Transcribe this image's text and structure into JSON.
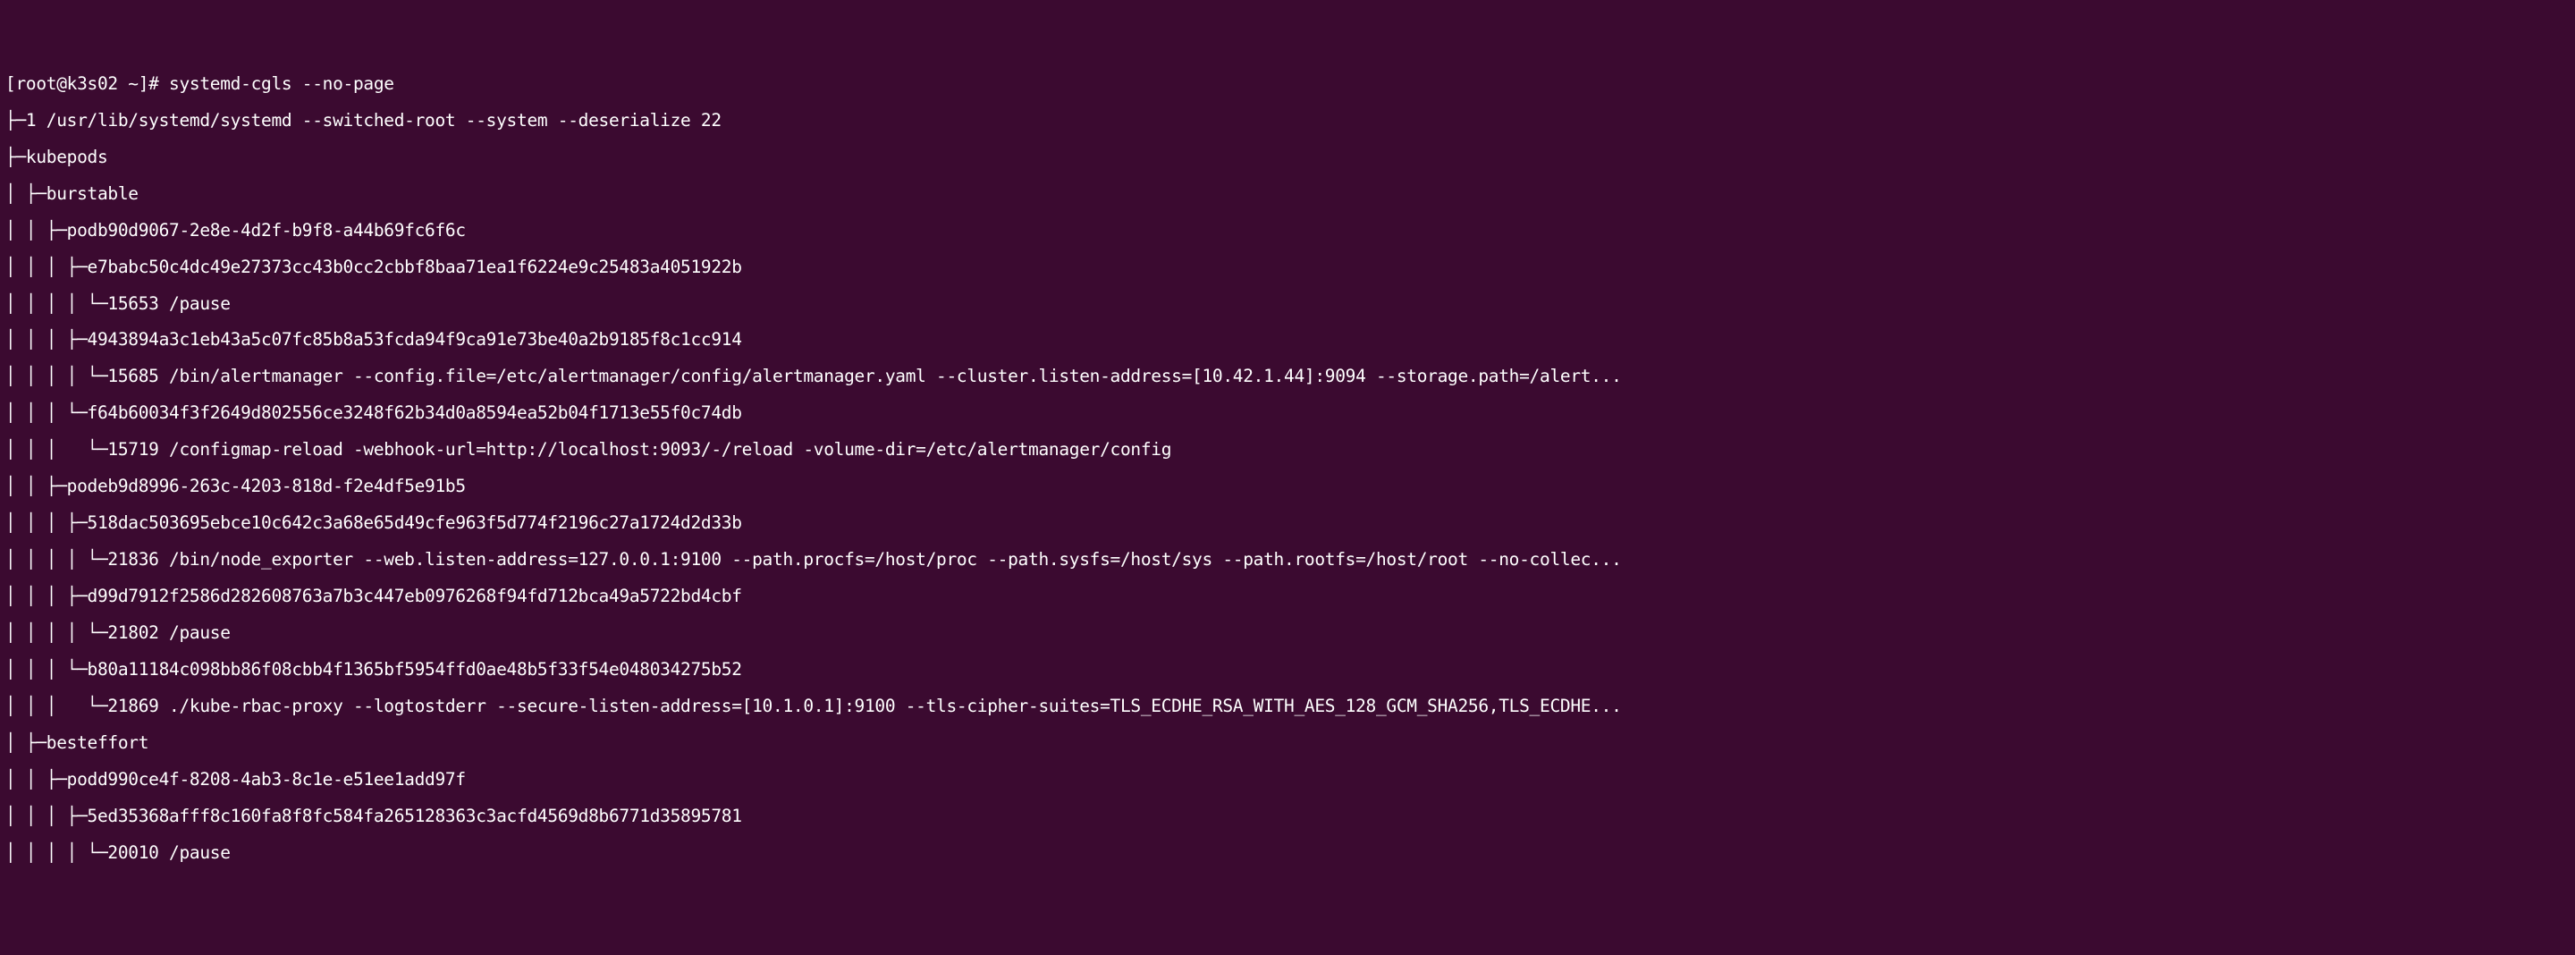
{
  "prompt": "[root@k3s02 ~]# ",
  "command": "systemd-cgls --no-page",
  "lines": [
    "├─1 /usr/lib/systemd/systemd --switched-root --system --deserialize 22",
    "├─kubepods",
    "│ ├─burstable",
    "│ │ ├─podb90d9067-2e8e-4d2f-b9f8-a44b69fc6f6c",
    "│ │ │ ├─e7babc50c4dc49e27373cc43b0cc2cbbf8baa71ea1f6224e9c25483a4051922b",
    "│ │ │ │ └─15653 /pause",
    "│ │ │ ├─4943894a3c1eb43a5c07fc85b8a53fcda94f9ca91e73be40a2b9185f8c1cc914",
    "│ │ │ │ └─15685 /bin/alertmanager --config.file=/etc/alertmanager/config/alertmanager.yaml --cluster.listen-address=[10.42.1.44]:9094 --storage.path=/alert...",
    "│ │ │ └─f64b60034f3f2649d802556ce3248f62b34d0a8594ea52b04f1713e55f0c74db",
    "│ │ │   └─15719 /configmap-reload -webhook-url=http://localhost:9093/-/reload -volume-dir=/etc/alertmanager/config",
    "│ │ ├─podeb9d8996-263c-4203-818d-f2e4df5e91b5",
    "│ │ │ ├─518dac503695ebce10c642c3a68e65d49cfe963f5d774f2196c27a1724d2d33b",
    "│ │ │ │ └─21836 /bin/node_exporter --web.listen-address=127.0.0.1:9100 --path.procfs=/host/proc --path.sysfs=/host/sys --path.rootfs=/host/root --no-collec...",
    "│ │ │ ├─d99d7912f2586d282608763a7b3c447eb0976268f94fd712bca49a5722bd4cbf",
    "│ │ │ │ └─21802 /pause",
    "│ │ │ └─b80a11184c098bb86f08cbb4f1365bf5954ffd0ae48b5f33f54e048034275b52",
    "│ │ │   └─21869 ./kube-rbac-proxy --logtostderr --secure-listen-address=[10.1.0.1]:9100 --tls-cipher-suites=TLS_ECDHE_RSA_WITH_AES_128_GCM_SHA256,TLS_ECDHE...",
    "│ ├─besteffort",
    "│ │ ├─podd990ce4f-8208-4ab3-8c1e-e51ee1add97f",
    "│ │ │ ├─5ed35368afff8c160fa8f8fc584fa265128363c3acfd4569d8b6771d35895781",
    "│ │ │ │ └─20010 /pause"
  ]
}
